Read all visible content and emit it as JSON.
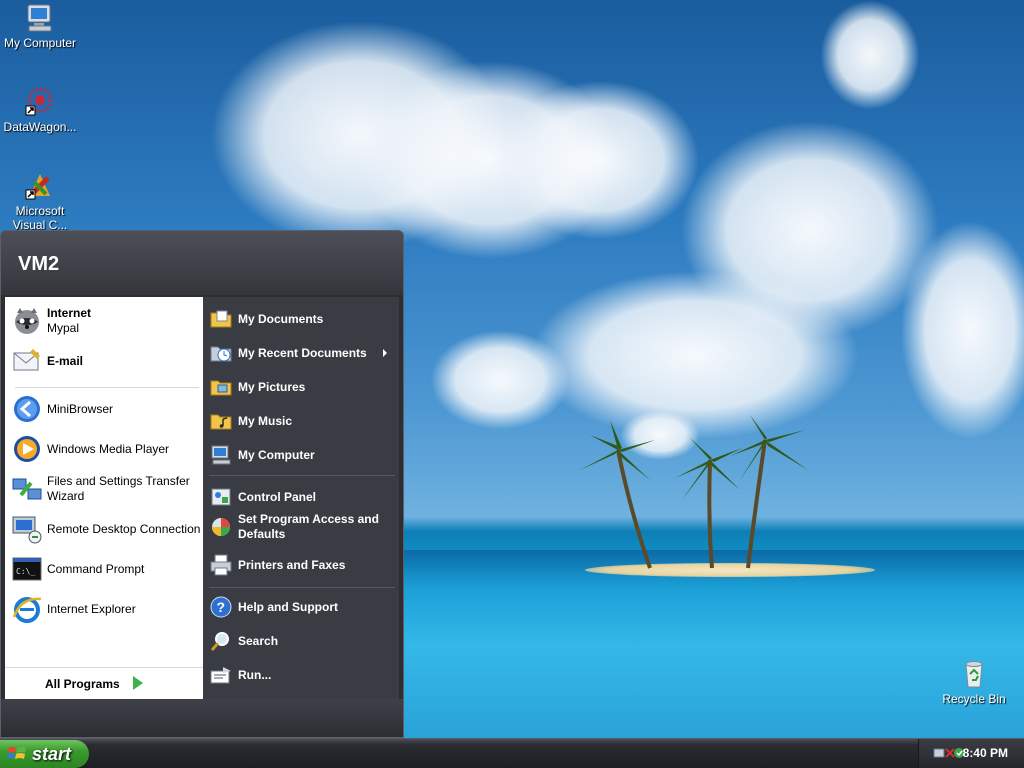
{
  "desktop": {
    "icons": [
      {
        "label": "My Computer"
      },
      {
        "label": "DataWagon..."
      },
      {
        "label": "Microsoft Visual C..."
      },
      {
        "label": "Recycle Bin"
      }
    ]
  },
  "start_menu": {
    "user_name": "VM2",
    "pinned": [
      {
        "title": "Internet",
        "subtitle": "Mypal"
      },
      {
        "title": "E-mail",
        "subtitle": ""
      }
    ],
    "recent": [
      {
        "label": "MiniBrowser"
      },
      {
        "label": "Windows Media Player"
      },
      {
        "label": "Files and Settings Transfer Wizard"
      },
      {
        "label": "Remote Desktop Connection"
      },
      {
        "label": "Command Prompt"
      },
      {
        "label": "Internet Explorer"
      }
    ],
    "all_programs": "All Programs",
    "right": [
      {
        "label": "My Documents"
      },
      {
        "label": "My Recent Documents"
      },
      {
        "label": "My Pictures"
      },
      {
        "label": "My Music"
      },
      {
        "label": "My Computer"
      },
      {
        "label": "Control Panel"
      },
      {
        "label": "Set Program Access and Defaults"
      },
      {
        "label": "Printers and Faxes"
      },
      {
        "label": "Help and Support"
      },
      {
        "label": "Search"
      },
      {
        "label": "Run..."
      }
    ]
  },
  "taskbar": {
    "start_label": "start",
    "clock": "8:40 PM"
  },
  "colors": {
    "start_green": "#3a9a2e",
    "menu_dark": "#3a3c43",
    "all_programs_arrow": "#3bb34a"
  }
}
